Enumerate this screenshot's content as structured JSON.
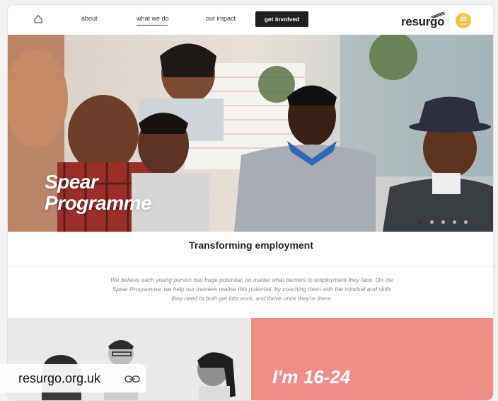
{
  "nav": {
    "home_icon": "home-icon",
    "links": [
      "about",
      "what we do",
      "our impact"
    ],
    "cta": "get involved",
    "brand": "resurgo",
    "badge": {
      "num": "20",
      "label": "years",
      "color": "#e8c547"
    }
  },
  "hero": {
    "title_line1": "Spear",
    "title_line2": "Programme",
    "carousel": {
      "count": 5,
      "active": 1
    }
  },
  "subtitle": "Transforming employment",
  "intro": "We believe each young person has huge potential, no matter what barriers to employment they face. On the Spear Programme, we help our trainees realise this potential, by coaching them with the mindset and skills they need to both get into work, and thrive once they're there.",
  "panel": {
    "age_text": "I'm 16-24",
    "accent": "#ef8d87"
  },
  "browser": {
    "url": "resurgo.org.uk",
    "link_icon": "link-icon"
  }
}
